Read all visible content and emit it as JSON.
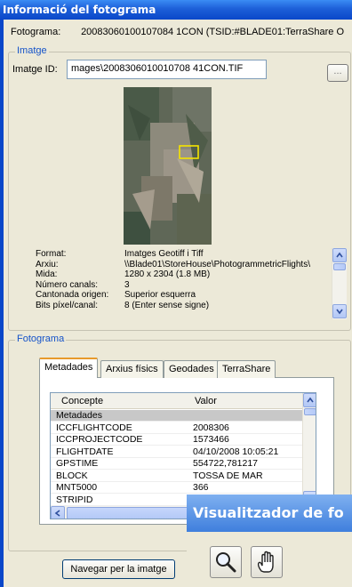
{
  "window": {
    "title": "Informació del fotograma"
  },
  "fotograma": {
    "label": "Fotograma:",
    "value": "20083060100107084 1CON (TSID:#BLADE01:TerraShare O"
  },
  "imatge_group": {
    "title": "Imatge",
    "id_label": "Imatge ID:",
    "id_value": "mages\\2008306010010708 41CON.TIF",
    "browse_label": "..."
  },
  "info_rows": [
    {
      "key": "Format:",
      "value": "Imatges Geotiff i Tiff"
    },
    {
      "key": "Arxiu:",
      "value": "\\\\Blade01\\StoreHouse\\PhotogrammetricFlights\\"
    },
    {
      "key": "Mida:",
      "value": "1280 x 2304  (1.8 MB)"
    },
    {
      "key": "Número canals:",
      "value": "3"
    },
    {
      "key": "Cantonada origen:",
      "value": "Superior esquerra"
    },
    {
      "key": "Bits píxel/canal:",
      "value": "8 (Enter sense signe)"
    }
  ],
  "fotograma_group": {
    "title": "Fotograma"
  },
  "tabs": [
    {
      "label": "Metadades",
      "active": true
    },
    {
      "label": "Arxius físics",
      "active": false
    },
    {
      "label": "Geodades",
      "active": false
    },
    {
      "label": "TerraShare",
      "active": false
    }
  ],
  "grid": {
    "columns": [
      "Concepte",
      "Valor"
    ],
    "rows": [
      {
        "concept": "Metadades",
        "value": "",
        "highlight": true
      },
      {
        "concept": "ICCFLIGHTCODE",
        "value": "2008306"
      },
      {
        "concept": "ICCPROJECTCODE",
        "value": "1573466"
      },
      {
        "concept": "FLIGHTDATE",
        "value": "04/10/2008 10:05:21"
      },
      {
        "concept": "GPSTIME",
        "value": "554722,781217"
      },
      {
        "concept": "BLOCK",
        "value": "TOSSA DE MAR"
      },
      {
        "concept": "MNT5000",
        "value": "366"
      },
      {
        "concept": "STRIPID",
        "value": ""
      }
    ]
  },
  "buttons": {
    "navigate": "Navegar per la imatge"
  },
  "viewer": {
    "title": "Visualitzador de fo",
    "tools": [
      "zoom",
      "pan"
    ]
  },
  "colors": {
    "titlebar": "#0a47c9",
    "group_title": "#1553c9",
    "active_tab": "#e89a2c",
    "selection_box": "#f5e400"
  }
}
